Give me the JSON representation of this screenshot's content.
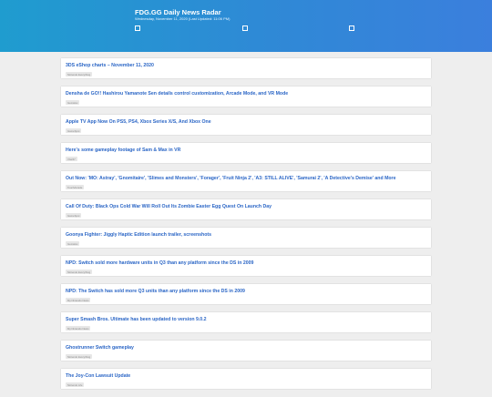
{
  "header": {
    "title": "FDG.GG Daily News Radar",
    "subtitle": "Wednesday, November 11, 2020 (Last Updated: 11:06 PM)"
  },
  "articles": [
    {
      "title": "3DS eShop charts – November 11, 2020",
      "source": "Nintendo Everything"
    },
    {
      "title": "Densha de GO!! Hashirou Yamanote Sen details control customization, Arcade Mode, and VR Mode",
      "source": "Gematsu"
    },
    {
      "title": "Apple TV App Now On PS5, PS4, Xbox Series X/S, And Xbox One",
      "source": "GameSpot"
    },
    {
      "title": "Here's some gameplay footage of Sam & Max in VR",
      "source": "VG247"
    },
    {
      "title": "Out Now: 'MO: Astray', 'Gnomitaire', 'Slimes and Monsters', 'Forager', 'Fruit Ninja 2', 'A3: STILL ALIVE', 'Samurai 2', 'A Detective's Demise' and More",
      "source": "TouchArcade"
    },
    {
      "title": "Call Of Duty: Black Ops Cold War Will Roll Out Its Zombie Easter Egg Quest On Launch Day",
      "source": "GameSpot"
    },
    {
      "title": "Goonya Fighter: Jiggly Haptic Edition launch trailer, screenshots",
      "source": "Gematsu"
    },
    {
      "title": "NPD: Switch sold more hardware units in Q3 than any platform since the DS in 2009",
      "source": "Nintendo Everything"
    },
    {
      "title": "NPD: The Switch has sold more Q3 units than any platform since the DS in 2009",
      "source": "My Nintendo News"
    },
    {
      "title": "Super Smash Bros. Ultimate has been updated to version 9.0.2",
      "source": "My Nintendo News"
    },
    {
      "title": "Ghostrunner Switch gameplay",
      "source": "Nintendo Everything"
    },
    {
      "title": "The Joy-Con Lawsuit Update",
      "source": "Nintendo Life"
    }
  ]
}
